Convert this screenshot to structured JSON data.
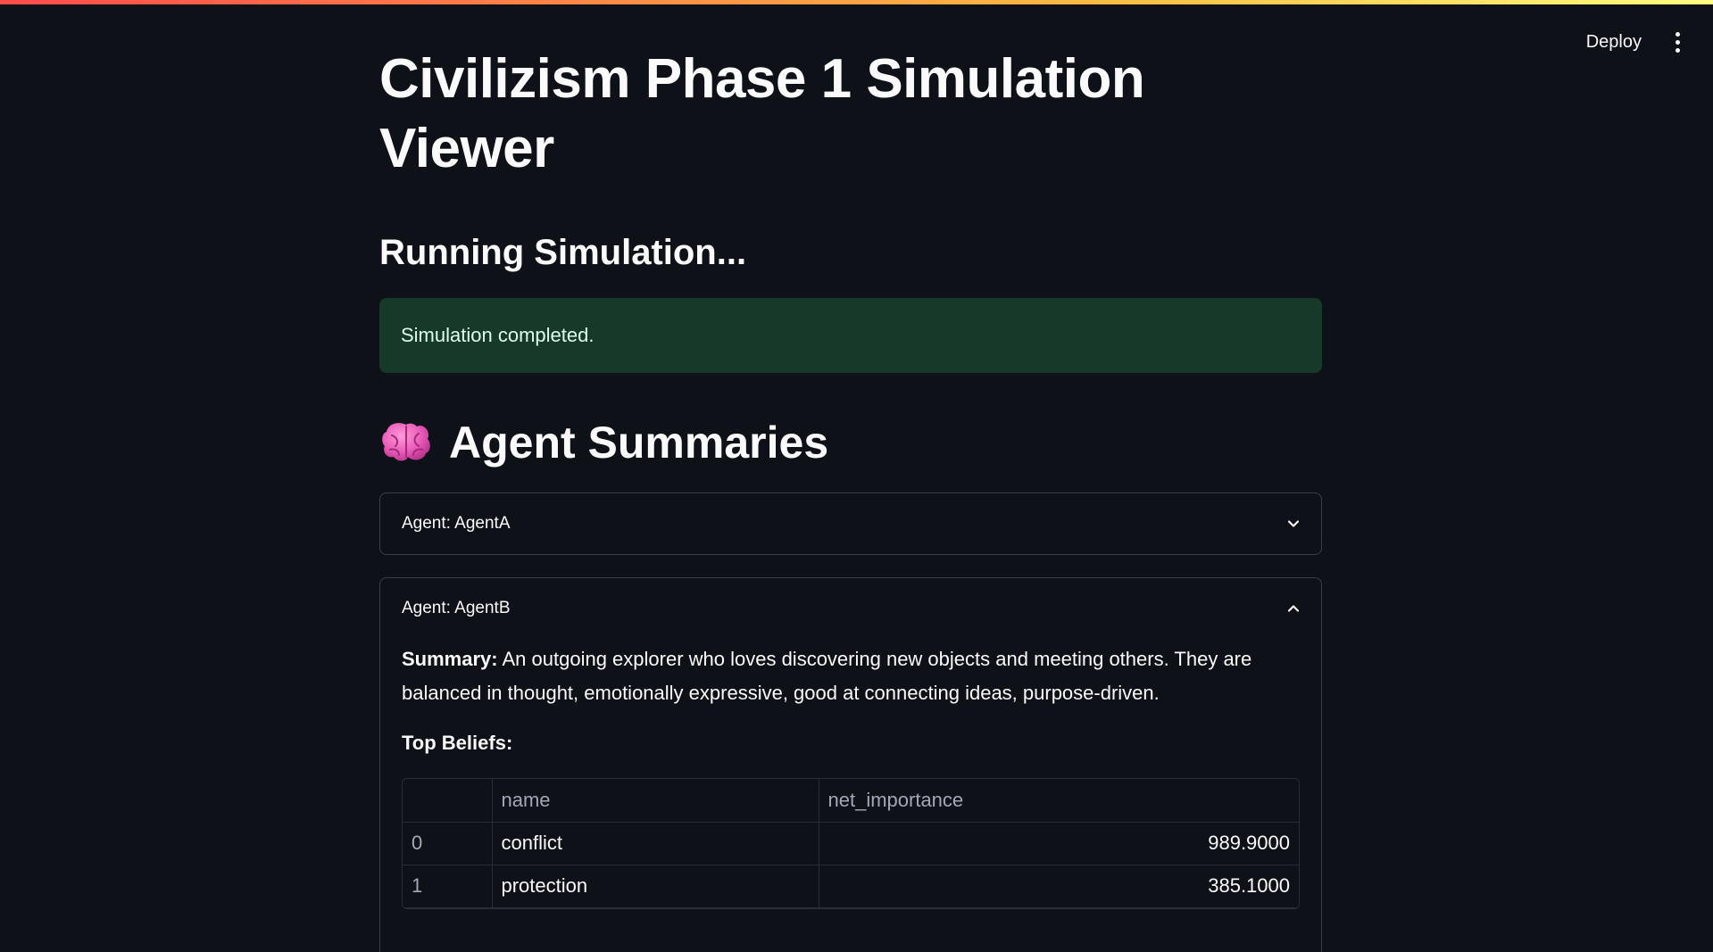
{
  "toolbar": {
    "deploy_label": "Deploy"
  },
  "page_title": "Civilizism Phase 1 Simulation Viewer",
  "section_heading": "Running Simulation...",
  "alert": {
    "message": "Simulation completed.",
    "color": "#173928"
  },
  "summaries": {
    "icon": "brain-icon",
    "heading": "Agent Summaries"
  },
  "agents": [
    {
      "label": "Agent: AgentA",
      "expanded": false
    },
    {
      "label": "Agent: AgentB",
      "expanded": true,
      "summary_label": "Summary:",
      "summary_text": " An outgoing explorer who loves discovering new objects and meeting others. They are balanced in thought, emotionally expressive, good at connecting ideas, purpose-driven.",
      "beliefs_label": "Top Beliefs:",
      "table": {
        "columns": [
          "",
          "name",
          "net_importance"
        ],
        "rows": [
          {
            "index": "0",
            "name": "conflict",
            "net_importance": "989.9000"
          },
          {
            "index": "1",
            "name": "protection",
            "net_importance": "385.1000"
          }
        ]
      }
    }
  ],
  "colors": {
    "background": "#0e1117",
    "text": "#fafafa",
    "border": "#3b3d47"
  }
}
